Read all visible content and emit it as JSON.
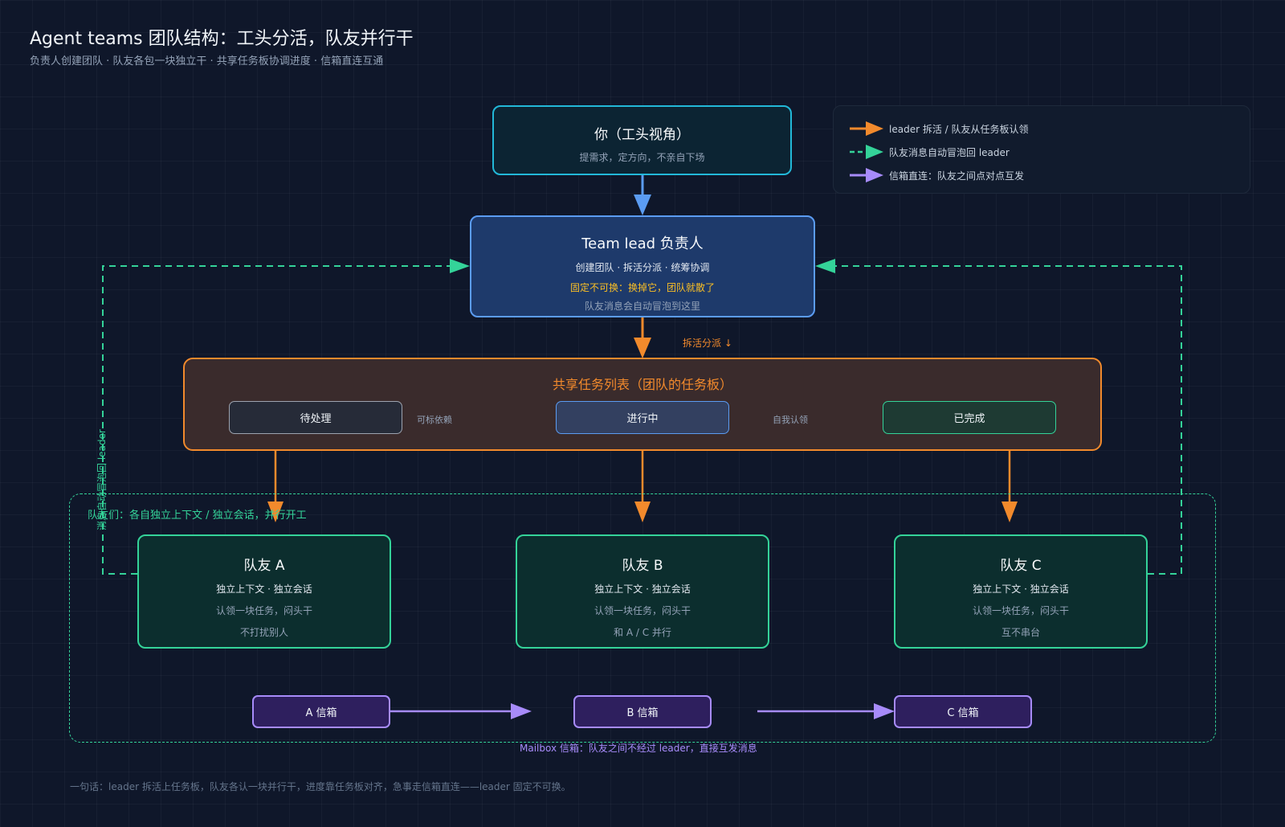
{
  "header": {
    "title": "Agent teams 团队结构：工头分活，队友并行干",
    "subtitle": "负责人创建团队 · 队友各包一块独立干 · 共享任务板协调进度 · 信箱直连互通"
  },
  "you": {
    "title": "你（工头视角）",
    "desc": "提需求，定方向，不亲自下场"
  },
  "lead": {
    "title": "Team lead 负责人",
    "line1": "创建团队 · 拆活分派 · 统筹协调",
    "line2": "固定不可换：换掉它，团队就散了",
    "line3": "队友消息会自动冒泡到这里"
  },
  "assign_label": "拆活分派 ↓",
  "board": {
    "title": "共享任务列表（团队的任务板）",
    "states": {
      "pending": "待处理",
      "in_progress": "进行中",
      "done": "已完成"
    },
    "hint_dependency": "可标依赖",
    "hint_claim": "自我认领"
  },
  "team": {
    "label": "队友们：各自独立上下文 / 独立会话，并行开工",
    "bubble_label": "消息自动冒泡回 leader",
    "mates": [
      {
        "name": "队友 A",
        "ctx": "独立上下文 · 独立会话",
        "task": "认领一块任务，闷头干",
        "note": "不打扰别人"
      },
      {
        "name": "队友 B",
        "ctx": "独立上下文 · 独立会话",
        "task": "认领一块任务，闷头干",
        "note": "和 A / C 并行"
      },
      {
        "name": "队友 C",
        "ctx": "独立上下文 · 独立会话",
        "task": "认领一块任务，闷头干",
        "note": "互不串台"
      }
    ],
    "mailboxes": [
      "A 信箱",
      "B 信箱",
      "C 信箱"
    ],
    "mailbox_caption": "Mailbox 信箱：队友之间不经过 leader，直接互发消息"
  },
  "legend": {
    "items": [
      {
        "label": "leader 拆活 / 队友从任务板认领",
        "color": "#f28a2c",
        "style": "solid"
      },
      {
        "label": "队友消息自动冒泡回 leader",
        "color": "#34d399",
        "style": "dashed"
      },
      {
        "label": "信箱直连：队友之间点对点互发",
        "color": "#a78bfa",
        "style": "solid"
      }
    ]
  },
  "footer": "一句话：leader 拆活上任务板，队友各认一块并行干，进度靠任务板对齐，急事走信箱直连——leader 固定不可换。",
  "colors": {
    "background": "#0f172a",
    "you_border": "#22b8d8",
    "lead_border": "#5b9cf2",
    "board_border": "#f28a2c",
    "mate_border": "#34d399",
    "mailbox_border": "#a78bfa",
    "warning_text": "#fbbf24"
  }
}
